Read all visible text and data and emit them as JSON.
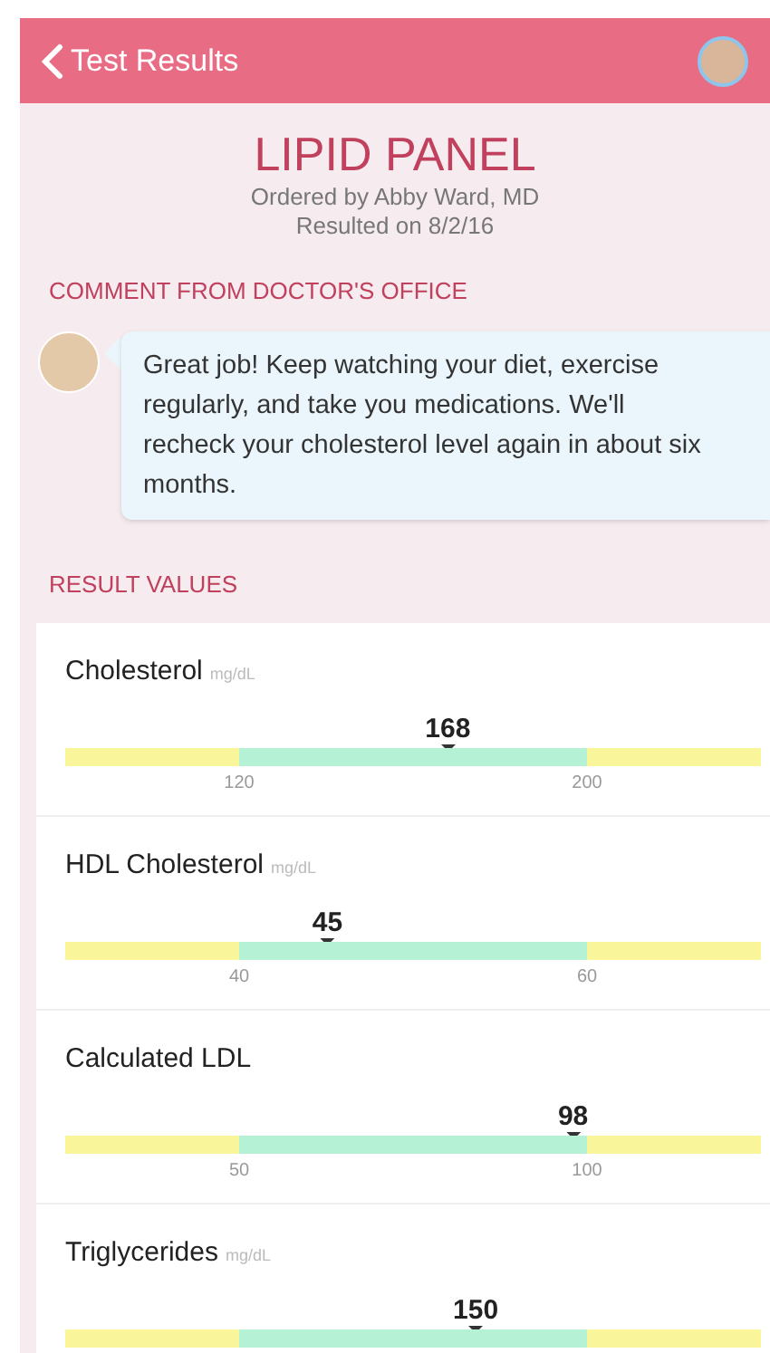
{
  "header": {
    "back_label": "Test Results"
  },
  "panel": {
    "title": "LIPID PANEL",
    "ordered_by": "Ordered by Abby Ward, MD",
    "resulted_on": "Resulted on 8/2/16"
  },
  "comment": {
    "heading": "COMMENT FROM DOCTOR'S OFFICE",
    "text": "Great job! Keep watching your diet, exercise regularly, and take you medications. We'll recheck your cholesterol level again in about six months."
  },
  "results": {
    "heading": "RESULT VALUES",
    "items": [
      {
        "name": "Cholesterol",
        "unit": "mg/dL",
        "value": "168",
        "level": 0.55,
        "low": "120",
        "high": "200"
      },
      {
        "name": "HDL Cholesterol",
        "unit": "mg/dL",
        "value": "45",
        "level": 0.377,
        "low": "40",
        "high": "60"
      },
      {
        "name": "Calculated LDL",
        "value": "98",
        "level": 0.73,
        "low": "50",
        "high": "100"
      },
      {
        "name": "Triglycerides",
        "unit": "mg/dL",
        "value": "150",
        "level": 0.59
      }
    ]
  }
}
